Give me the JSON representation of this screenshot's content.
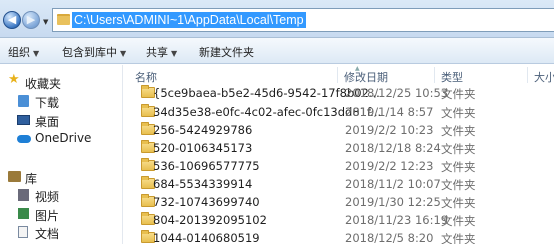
{
  "address": {
    "path": "C:\\Users\\ADMINI~1\\AppData\\Local\\Temp"
  },
  "nav": {
    "back_glyph": "◀",
    "forward_glyph": "▶",
    "dropdown_glyph": "▼"
  },
  "toolbar": {
    "organize": "组织",
    "include": "包含到库中",
    "share": "共享",
    "new_folder": "新建文件夹",
    "caret": "▼"
  },
  "sidebar": {
    "favorites": "收藏夹",
    "downloads": "下载",
    "desktop": "桌面",
    "onedrive": "OneDrive",
    "libraries": "库",
    "videos": "视频",
    "pictures": "图片",
    "documents": "文档"
  },
  "columns": {
    "name": "名称",
    "date": "修改日期",
    "type": "类型",
    "size": "大小"
  },
  "files": [
    {
      "name": "{5ce9baea-b5e2-45d6-9542-17f8b02...",
      "date": "2018/12/25 10:53",
      "type": "文件夹"
    },
    {
      "name": "34d35e38-e0fc-4c02-afec-0fc13dd81f...",
      "date": "2019/1/14 8:57",
      "type": "文件夹"
    },
    {
      "name": "256-5424929786",
      "date": "2019/2/2 10:23",
      "type": "文件夹"
    },
    {
      "name": "520-0106345173",
      "date": "2018/12/18 8:24",
      "type": "文件夹"
    },
    {
      "name": "536-10696577775",
      "date": "2019/2/2 12:23",
      "type": "文件夹"
    },
    {
      "name": "684-5534339914",
      "date": "2018/11/2 10:07",
      "type": "文件夹"
    },
    {
      "name": "732-10743699740",
      "date": "2019/1/30 12:25",
      "type": "文件夹"
    },
    {
      "name": "804-201392095102",
      "date": "2018/11/23 16:19",
      "type": "文件夹"
    },
    {
      "name": "1044-0140680519",
      "date": "2018/12/5 8:20",
      "type": "文件夹"
    }
  ],
  "colors": {
    "selection": "#3399ff",
    "folder": "#e8bf4f",
    "chrome": "#dbe9f7"
  }
}
